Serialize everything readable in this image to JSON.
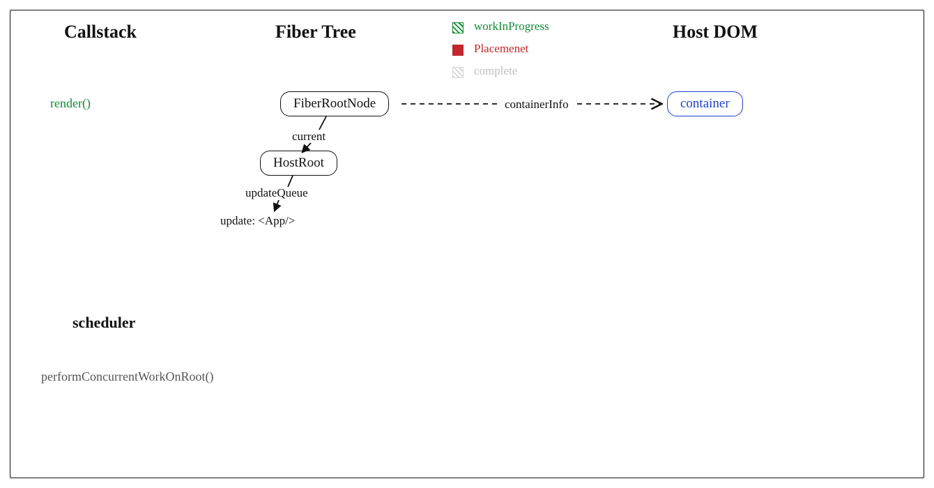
{
  "headings": {
    "callstack": "Callstack",
    "fiber_tree": "Fiber Tree",
    "host_dom": "Host DOM",
    "scheduler": "scheduler"
  },
  "callstack": {
    "item0": "render()"
  },
  "legend": {
    "wip": "workInProgress",
    "placement": "Placemenet",
    "complete": "complete"
  },
  "nodes": {
    "fiber_root": "FiberRootNode",
    "host_root": "HostRoot",
    "container": "container"
  },
  "edges": {
    "current": "current",
    "container_info": "containerInfo",
    "update_queue": "updateQueue",
    "update_app": "update: <App/>"
  },
  "scheduler": {
    "item0": "performConcurrentWorkOnRoot()"
  }
}
